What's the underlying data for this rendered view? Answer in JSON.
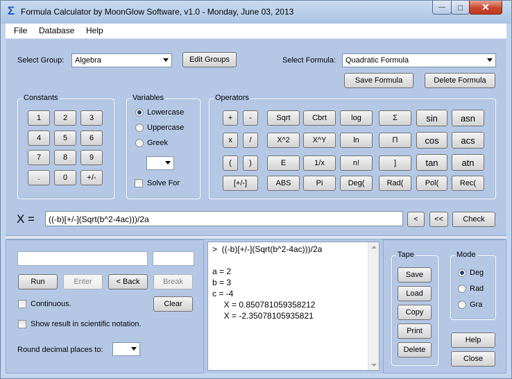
{
  "window": {
    "title": "Formula Calculator by MoonGlow Software, v1.0  -  Monday, June 03, 2013",
    "app_icon": "Σ",
    "minimize_label": "—",
    "maximize_label": "□",
    "close_label": "✕"
  },
  "menu": [
    "File",
    "Database",
    "Help"
  ],
  "group": {
    "label": "Select Group:",
    "value": "Algebra",
    "edit_button": "Edit Groups"
  },
  "formula": {
    "label": "Select Formula:",
    "value": "Quadratic Formula",
    "save_button": "Save Formula",
    "delete_button": "Delete Formula"
  },
  "constants": {
    "title": "Constants",
    "keys": [
      "1",
      "2",
      "3",
      "4",
      "5",
      "6",
      "7",
      "8",
      "9",
      ".",
      "0",
      "+/-"
    ]
  },
  "variables": {
    "title": "Variables",
    "options": [
      "Lowercase",
      "Uppercase",
      "Greek"
    ],
    "selected": "Lowercase",
    "solve_for": "Solve For"
  },
  "operators": {
    "title": "Operators",
    "rows": [
      [
        "+",
        "-",
        "Sqrt",
        "Cbrt",
        "log",
        "Σ",
        "sin",
        "asn"
      ],
      [
        "x",
        "/",
        "X^2",
        "X^Y",
        "ln",
        "Π",
        "cos",
        "acs"
      ],
      [
        "(",
        ")",
        "E",
        "1/x",
        "n!",
        "]",
        "tan",
        "atn"
      ],
      [
        "[+/-]",
        "ABS",
        "Pi",
        "Deg(",
        "Rad(",
        "Pol(",
        "Rec("
      ]
    ]
  },
  "expression": {
    "label": "X  =",
    "value": "((-b)[+/-](Sqrt(b^2-4ac)))/2a",
    "back_one": "<",
    "back_all": "<<",
    "check": "Check"
  },
  "run_panel": {
    "input_value": "",
    "small_input_value": "",
    "run": "Run",
    "enter": "Enter",
    "back": "< Back",
    "break": "Break",
    "continuous": "Continuous.",
    "clear": "Clear",
    "scientific": "Show result in scientific notation.",
    "round_label": "Round decimal places to:"
  },
  "tape_output": [
    ">  ((-b)[+/-](Sqrt(b^2-4ac)))/2a",
    "",
    "a = 2",
    "b = 3",
    "c = -4",
    "     X = 0.850781059358212",
    "     X = -2.35078105935821"
  ],
  "tape": {
    "title": "Tape",
    "buttons": [
      "Save",
      "Load",
      "Copy",
      "Print",
      "Delete"
    ]
  },
  "mode": {
    "title": "Mode",
    "options": [
      "Deg",
      "Rad",
      "Gra"
    ],
    "selected": "Deg"
  },
  "help": "Help",
  "close": "Close"
}
